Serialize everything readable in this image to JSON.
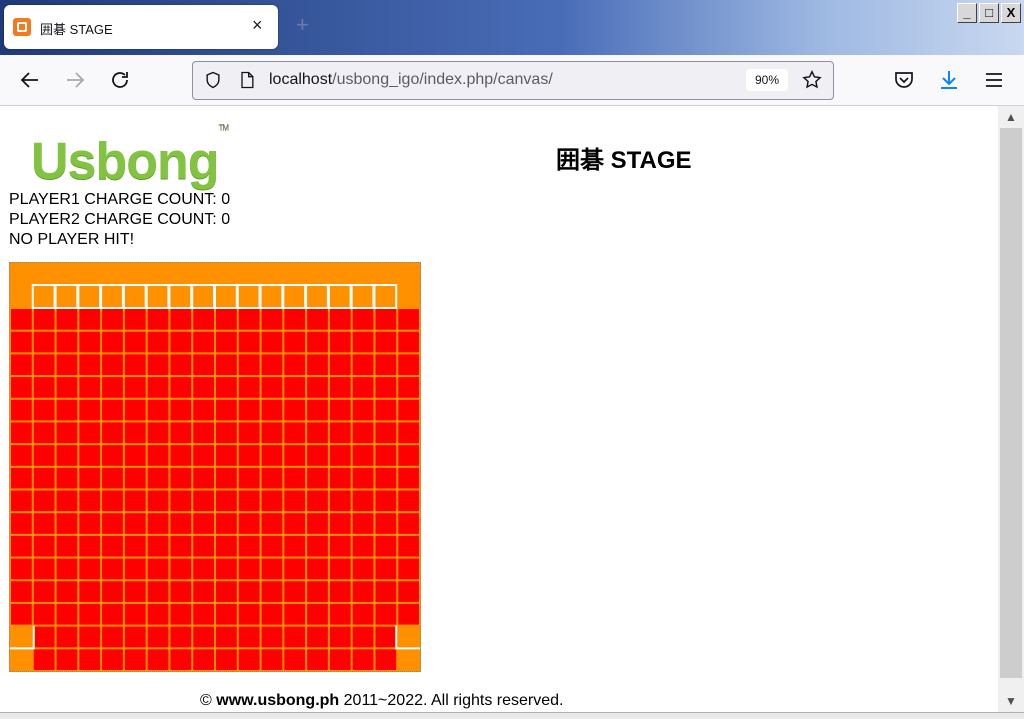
{
  "browser": {
    "tab_title": "囲碁 STAGE",
    "tab_close": "×",
    "new_tab": "+",
    "url_host": "localhost",
    "url_path": "/usbong_igo/index.php/canvas/",
    "zoom": "90%",
    "window_controls": [
      "_",
      "□",
      "X"
    ]
  },
  "page": {
    "logo_text": "Usbong",
    "logo_tm": "TM",
    "title": "囲碁 STAGE",
    "player1_charge": "PLAYER1 CHARGE COUNT: 0",
    "player2_charge": "PLAYER2 CHARGE COUNT: 0",
    "hit_status": "NO PLAYER HIT!",
    "footer_symbol": "©",
    "footer_site": "www.usbong.ph",
    "footer_rest": " 2011~2022. All rights reserved."
  },
  "board": {
    "columns": 18,
    "rows": 16,
    "colors": {
      "red": "#ff0000",
      "orange": "#ff9100",
      "grid": "#ffffff"
    }
  },
  "scrollbar": {
    "up": "▲",
    "down": "▼"
  }
}
